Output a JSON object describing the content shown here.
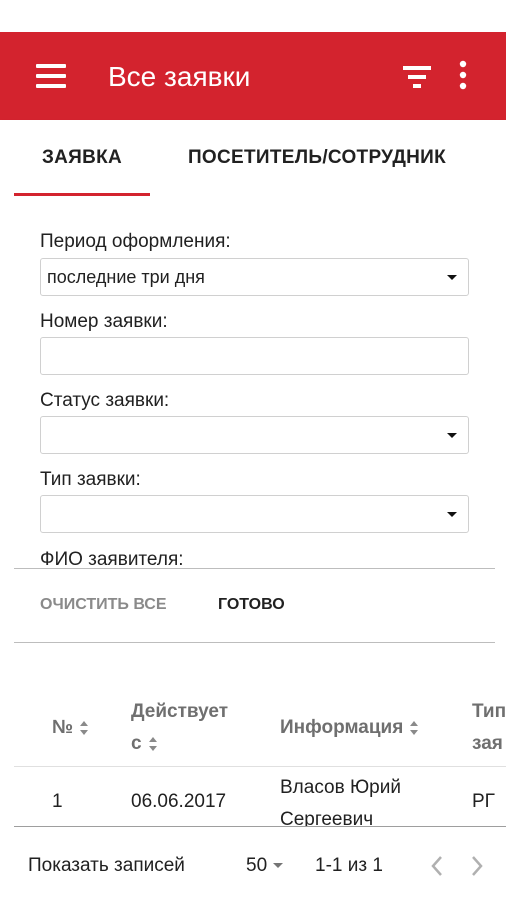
{
  "app": {
    "title": "Все заявки",
    "accent_color": "#d3232e",
    "icons": {
      "menu": "hamburger-menu-icon",
      "filter": "filter-icon",
      "more": "more-vertical-icon"
    }
  },
  "tabs": [
    {
      "label": "ЗАЯВКА",
      "active": true
    },
    {
      "label": "ПОСЕТИТЕЛЬ/СОТРУДНИК",
      "active": false
    }
  ],
  "filters": {
    "period": {
      "label": "Период оформления:",
      "value": "последние три дня"
    },
    "number": {
      "label": "Номер заявки:",
      "value": ""
    },
    "status": {
      "label": "Статус заявки:",
      "value": ""
    },
    "type": {
      "label": "Тип заявки:",
      "value": ""
    },
    "applicant": {
      "label": "ФИО заявителя:"
    }
  },
  "actions": {
    "clear_label": "ОЧИСТИТЬ ВСЕ",
    "done_label": "ГОТОВО"
  },
  "table": {
    "columns": {
      "num": "№",
      "valid_line1": "Действует",
      "valid_line2": "с",
      "info": "Информация",
      "type_line1": "Тип",
      "type_line2": "зая"
    },
    "rows": [
      {
        "num": "1",
        "valid_from": "06.06.2017",
        "info_line1": "Власов Юрий",
        "info_line2": "Сергеевич",
        "type": "РГ"
      }
    ]
  },
  "pagination": {
    "show_label": "Показать записей",
    "page_size": "50",
    "range": "1-1 из 1"
  }
}
